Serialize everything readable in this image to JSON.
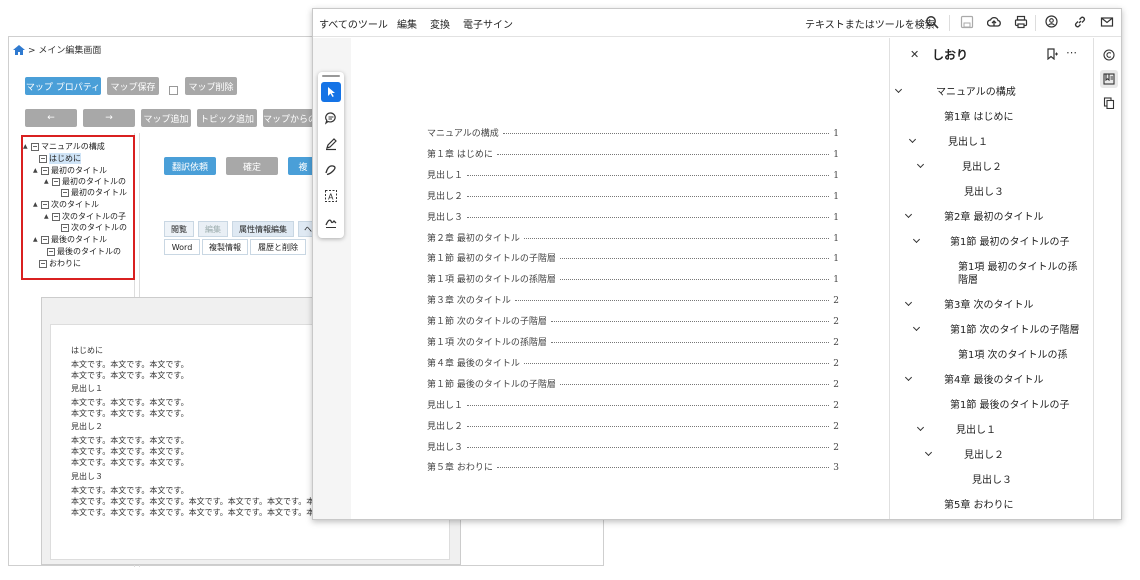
{
  "back_window": {
    "breadcrumb": "> メイン編集画面",
    "buttons_row1": [
      "マップ プロパティ",
      "マップ保存",
      "マップ削除"
    ],
    "buttons_row2": [
      "←",
      "→",
      "マップ追加",
      "トピック追加",
      "マップからの"
    ],
    "tree": [
      {
        "label": "マニュアルの構成"
      },
      {
        "label": "はじめに"
      },
      {
        "label": "最初のタイトル"
      },
      {
        "label": "最初のタイトルの"
      },
      {
        "label": "最初のタイトル"
      },
      {
        "label": "次のタイトル"
      },
      {
        "label": "次のタイトルの子"
      },
      {
        "label": "次のタイトルの"
      },
      {
        "label": "最後のタイトル"
      },
      {
        "label": "最後のタイトルの"
      },
      {
        "label": "おわりに"
      }
    ],
    "action_buttons": [
      "翻訳依頼",
      "確定",
      "複"
    ],
    "tabs_row1": [
      "閲覧",
      "編集",
      "属性情報編集",
      "ヘ"
    ],
    "tabs_row2": [
      "Word",
      "複製情報",
      "履歴と削除"
    ],
    "doc_lines": [
      "はじめに",
      "本文です。本文です。本文です。",
      "本文です。本文です。本文です。",
      "見出し１",
      "本文です。本文です。本文です。",
      "本文です。本文です。本文です。",
      "見出し２",
      "本文です。本文です。本文です。",
      "本文です。本文です。本文です。",
      "本文です。本文です。本文です。",
      "見出し３",
      "本文です。本文です。本文です。",
      "本文です。本文です。本文です。本文です。本文です。本文です。本文です。本文です。本文です。",
      "本文です。本文です。本文です。本文です。本文です。本文です。本文です。本文です。"
    ]
  },
  "front_window": {
    "menu": [
      "すべてのツール",
      "編集",
      "変換",
      "電子サイン"
    ],
    "search_placeholder": "テキストまたはツールを検索",
    "toc": [
      {
        "title": "マニュアルの構成",
        "page": "1"
      },
      {
        "title": "第１章 はじめに",
        "page": "1"
      },
      {
        "title": "見出し１",
        "page": "1"
      },
      {
        "title": "見出し２",
        "page": "1"
      },
      {
        "title": "見出し３",
        "page": "1"
      },
      {
        "title": "第２章 最初のタイトル",
        "page": "1"
      },
      {
        "title": "第１節 最初のタイトルの子階層",
        "page": "1"
      },
      {
        "title": "第１項 最初のタイトルの孫階層",
        "page": "1"
      },
      {
        "title": "第３章 次のタイトル",
        "page": "2"
      },
      {
        "title": "第１節 次のタイトルの子階層",
        "page": "2"
      },
      {
        "title": "第１項 次のタイトルの孫階層",
        "page": "2"
      },
      {
        "title": "第４章 最後のタイトル",
        "page": "2"
      },
      {
        "title": "第１節 最後のタイトルの子階層",
        "page": "2"
      },
      {
        "title": "見出し１",
        "page": "2"
      },
      {
        "title": "見出し２",
        "page": "2"
      },
      {
        "title": "見出し３",
        "page": "2"
      },
      {
        "title": "第５章 おわりに",
        "page": "3"
      }
    ],
    "bookmarks_title": "しおり",
    "bookmarks": [
      {
        "label": "マニュアルの構成"
      },
      {
        "label": "第1章 はじめに"
      },
      {
        "label": "見出し１"
      },
      {
        "label": "見出し２"
      },
      {
        "label": "見出し３"
      },
      {
        "label": "第2章 最初のタイトル"
      },
      {
        "label": "第1節 最初のタイトルの子"
      },
      {
        "label": "第1項 最初のタイトルの孫"
      },
      {
        "label": "階層"
      },
      {
        "label": "第3章 次のタイトル"
      },
      {
        "label": "第1節 次のタイトルの子階層"
      },
      {
        "label": "第1項 次のタイトルの孫"
      },
      {
        "label": "第4章 最後のタイトル"
      },
      {
        "label": "第1節 最後のタイトルの子"
      },
      {
        "label": "見出し１"
      },
      {
        "label": "見出し２"
      },
      {
        "label": "見出し３"
      },
      {
        "label": "第5章 おわりに"
      }
    ]
  },
  "colors": {
    "accent_blue": "#1473e6",
    "button_blue": "#4a9fd8",
    "highlight_red": "#d92020"
  }
}
